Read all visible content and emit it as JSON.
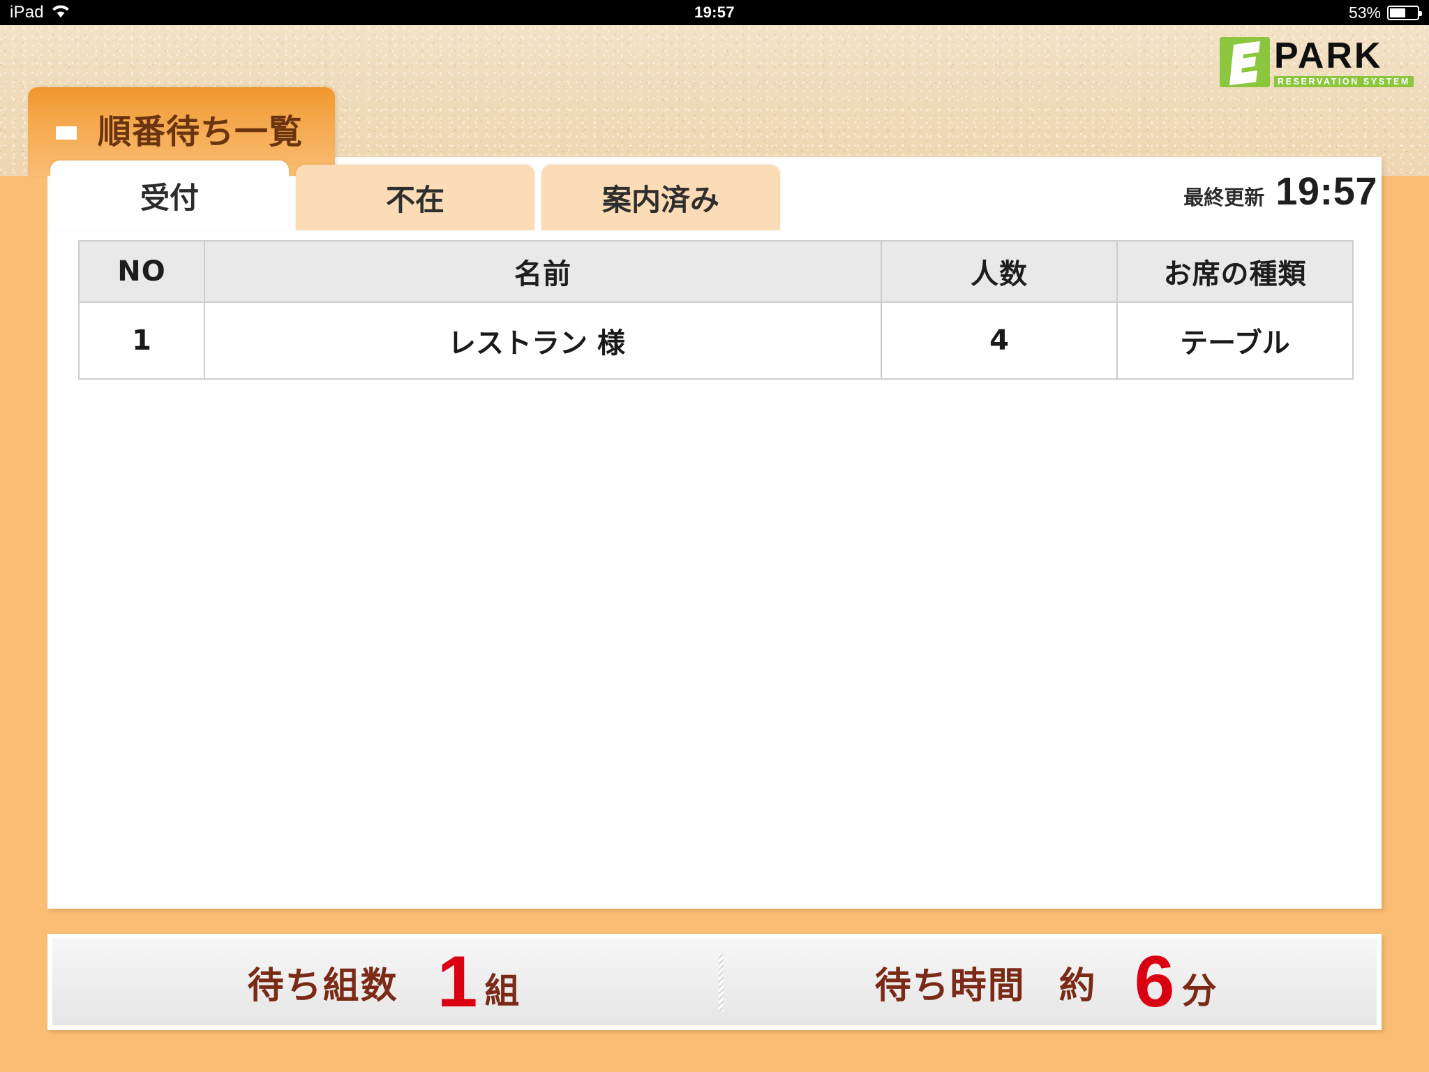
{
  "status_bar": {
    "device": "iPad",
    "wifi_icon": "wifi-icon",
    "time": "19:57",
    "battery_percent": "53%",
    "battery_level": 53
  },
  "header": {
    "logo": {
      "mark_letter": "E",
      "wordmark": "PARK",
      "tagline": "RESERVATION SYSTEM",
      "green": "#8cc63f",
      "black": "#0f0f0f"
    },
    "page_title": "順番待ち一覧",
    "title_marker_icon": "dash-marker-icon"
  },
  "tabs": [
    {
      "label": "受付",
      "active": true
    },
    {
      "label": "不在",
      "active": false
    },
    {
      "label": "案内済み",
      "active": false
    }
  ],
  "last_update": {
    "label": "最終更新",
    "time": "19:57"
  },
  "queue_table": {
    "columns": [
      "NO",
      "名前",
      "人数",
      "お席の種類"
    ],
    "rows": [
      {
        "no": "1",
        "name": "レストラン 様",
        "count": "4",
        "seat": "テーブル"
      }
    ]
  },
  "summary": {
    "groups": {
      "label": "待ち組数",
      "value": "1",
      "unit": "組"
    },
    "wait": {
      "label": "待ち時間",
      "approx": "約",
      "value": "6",
      "unit": "分"
    },
    "value_color": "#d90011",
    "label_color": "#7a2a15"
  },
  "theme": {
    "background_orange": "#f9bd74",
    "header_beige": "#f0dcbc",
    "tab_inactive": "#fbdcb6",
    "tab_active": "#ffffff",
    "title_tab_gradient_top": "#f0962b",
    "title_text": "#6b3410",
    "table_header_gray": "#e9e9e9",
    "table_border": "#cdcdcd"
  }
}
